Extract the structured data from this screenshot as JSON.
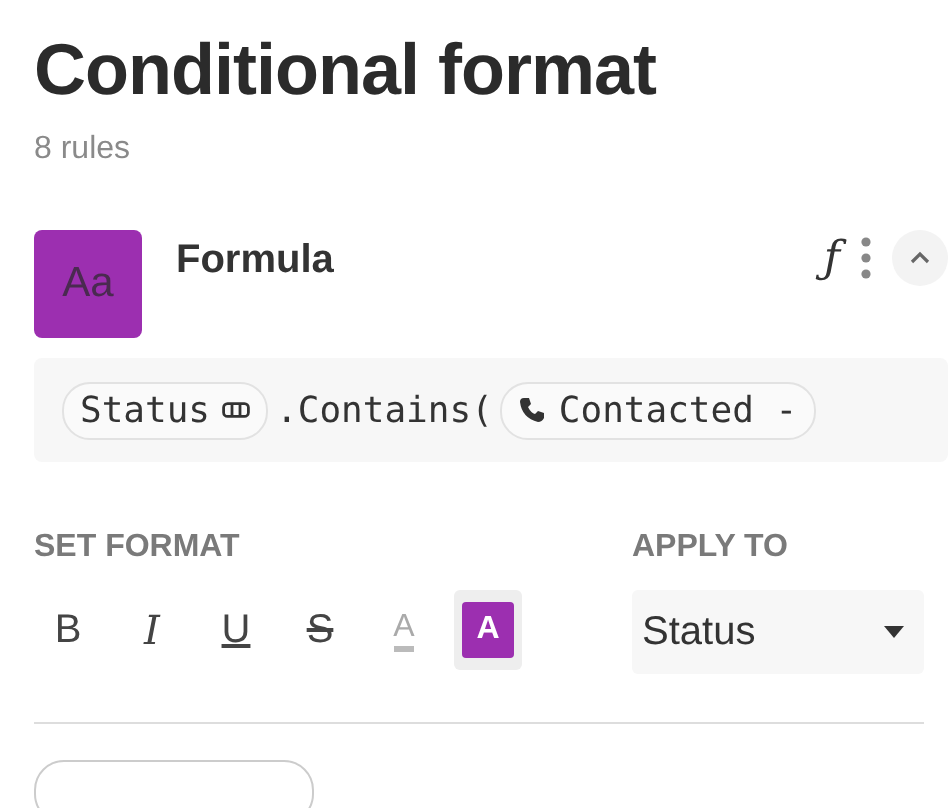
{
  "title": "Conditional format",
  "subtitle": "8 rules",
  "rule": {
    "swatch_text": "Aa",
    "name": "Formula",
    "function_icon": "ƒ",
    "expanded": true,
    "formula": [
      {
        "kind": "column_chip",
        "text": "Status"
      },
      {
        "kind": "plain",
        "text": ".Contains("
      },
      {
        "kind": "phone_chip",
        "text": "Contacted -"
      }
    ]
  },
  "set_format": {
    "label": "SET FORMAT",
    "buttons": [
      {
        "kind": "bold",
        "text": "B",
        "selected": false
      },
      {
        "kind": "italic",
        "text": "I",
        "selected": false
      },
      {
        "kind": "underline",
        "text": "U",
        "selected": false
      },
      {
        "kind": "strike",
        "text": "S",
        "selected": false
      },
      {
        "kind": "text_color",
        "text": "A",
        "selected": false
      },
      {
        "kind": "fill_color",
        "text": "A",
        "selected": true
      }
    ]
  },
  "apply_to": {
    "label": "APPLY TO",
    "value": "Status"
  }
}
